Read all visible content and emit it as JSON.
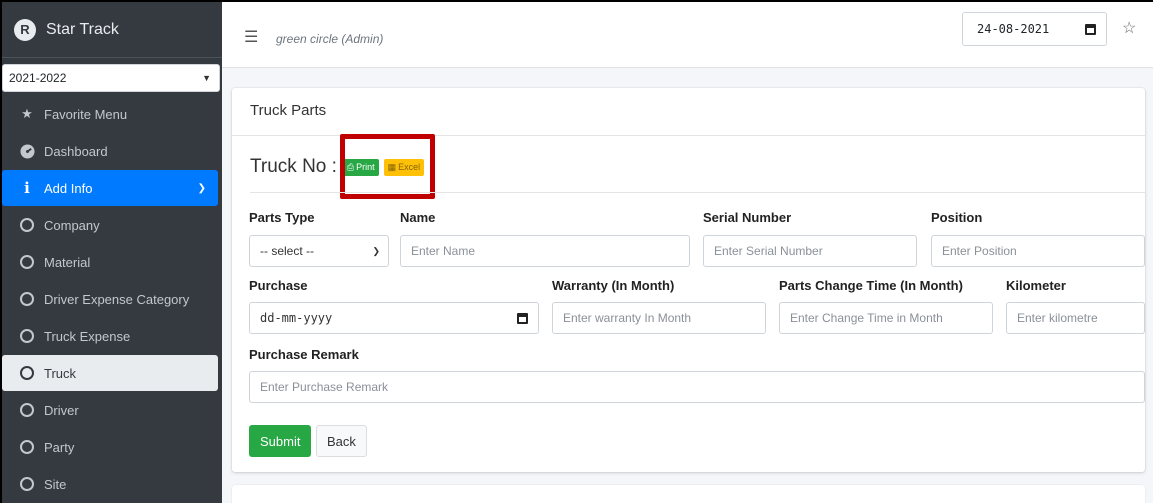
{
  "brand": {
    "name": "Star Track",
    "logo_letter": "R"
  },
  "sidebar": {
    "year": "2021-2022",
    "items": [
      {
        "label": "Favorite Menu",
        "icon": "star-icon"
      },
      {
        "label": "Dashboard",
        "icon": "dashboard-icon"
      },
      {
        "label": "Add Info",
        "icon": "info-icon"
      },
      {
        "label": "Company",
        "icon": "circle-icon"
      },
      {
        "label": "Material",
        "icon": "circle-icon"
      },
      {
        "label": "Driver Expense Category",
        "icon": "circle-icon"
      },
      {
        "label": "Truck Expense",
        "icon": "circle-icon"
      },
      {
        "label": "Truck",
        "icon": "circle-icon"
      },
      {
        "label": "Driver",
        "icon": "circle-icon"
      },
      {
        "label": "Party",
        "icon": "circle-icon"
      },
      {
        "label": "Site",
        "icon": "circle-icon"
      }
    ]
  },
  "header": {
    "user": "green circle (Admin)",
    "date": "24-08-2021"
  },
  "card": {
    "title": "Truck Parts",
    "truck_no_label": "Truck No :",
    "print_label": "Print",
    "excel_label": "Excel"
  },
  "form": {
    "parts_type": {
      "label": "Parts Type",
      "value": "-- select --"
    },
    "name": {
      "label": "Name",
      "placeholder": "Enter Name"
    },
    "serial": {
      "label": "Serial Number",
      "placeholder": "Enter Serial Number"
    },
    "position": {
      "label": "Position",
      "placeholder": "Enter Position"
    },
    "purchase": {
      "label": "Purchase",
      "value": "dd-mm-yyyy"
    },
    "warranty": {
      "label": "Warranty (In Month)",
      "placeholder": "Enter warranty In Month"
    },
    "change_time": {
      "label": "Parts Change Time (In Month)",
      "placeholder": "Enter Change Time in Month"
    },
    "kilometer": {
      "label": "Kilometer",
      "placeholder": "Enter kilometre"
    },
    "remark": {
      "label": "Purchase Remark",
      "placeholder": "Enter Purchase Remark"
    },
    "submit_label": "Submit",
    "back_label": "Back"
  },
  "colors": {
    "sidebar_bg": "#343a40",
    "primary": "#007bff",
    "success": "#28a745",
    "warning": "#ffc107",
    "highlight": "#c00000"
  }
}
